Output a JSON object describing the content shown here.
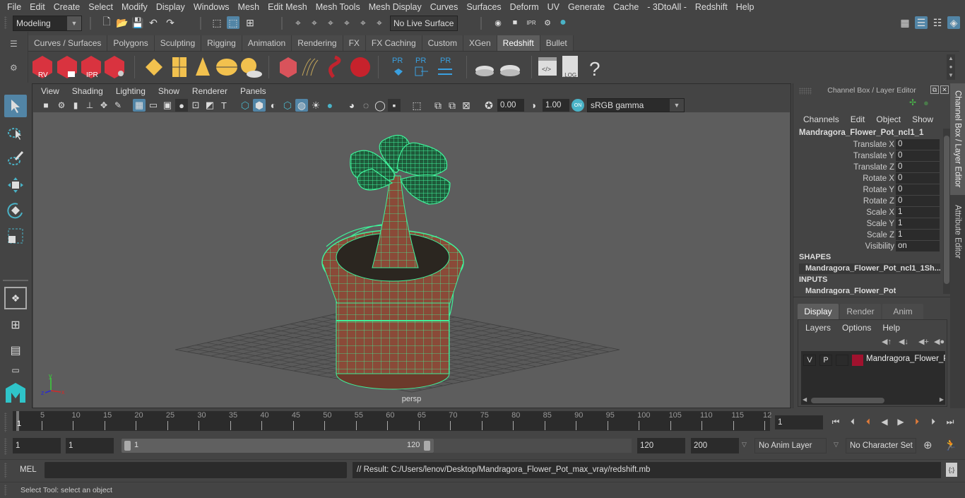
{
  "menubar": [
    "File",
    "Edit",
    "Create",
    "Select",
    "Modify",
    "Display",
    "Windows",
    "Mesh",
    "Edit Mesh",
    "Mesh Tools",
    "Mesh Display",
    "Curves",
    "Surfaces",
    "Deform",
    "UV",
    "Generate",
    "Cache",
    "- 3DtoAll -",
    "Redshift",
    "Help"
  ],
  "statusline": {
    "mode": "Modeling",
    "live_surface": "No Live Surface"
  },
  "shelf": {
    "tabs": [
      "Curves / Surfaces",
      "Polygons",
      "Sculpting",
      "Rigging",
      "Animation",
      "Rendering",
      "FX",
      "FX Caching",
      "Custom",
      "XGen",
      "Redshift",
      "Bullet"
    ],
    "active_tab": "Redshift",
    "icons": [
      {
        "name": "redshift-render-view",
        "label": "RV"
      },
      {
        "name": "redshift-batch-render",
        "label": ""
      },
      {
        "name": "redshift-ipr",
        "label": "IPR"
      },
      {
        "name": "redshift-render-settings",
        "label": ""
      },
      {
        "name": "redshift-light-rect",
        "label": ""
      },
      {
        "name": "redshift-light-portal",
        "label": ""
      },
      {
        "name": "redshift-light-spot",
        "label": ""
      },
      {
        "name": "redshift-dome-light",
        "label": ""
      },
      {
        "name": "redshift-sun-sky",
        "label": ""
      },
      {
        "name": "redshift-proxy",
        "label": ""
      },
      {
        "name": "redshift-hair",
        "label": ""
      },
      {
        "name": "redshift-volume",
        "label": ""
      },
      {
        "name": "redshift-sphere",
        "label": ""
      },
      {
        "name": "pr-material",
        "label": "PR"
      },
      {
        "name": "pr-export",
        "label": "PR"
      },
      {
        "name": "pr-convert",
        "label": "PR"
      },
      {
        "name": "bake-pies",
        "label": ""
      },
      {
        "name": "bake-pie",
        "label": ""
      },
      {
        "name": "script-editor",
        "label": ""
      },
      {
        "name": "log-file",
        "label": ".LOG"
      },
      {
        "name": "help",
        "label": "?"
      }
    ]
  },
  "viewport": {
    "menu": [
      "View",
      "Shading",
      "Lighting",
      "Show",
      "Renderer",
      "Panels"
    ],
    "exposure": "0.00",
    "gamma": "1.00",
    "color_space": "sRGB gamma",
    "camera_label": "persp",
    "axis": {
      "x": "x",
      "y": "y",
      "z": "z"
    }
  },
  "channelbox": {
    "title": "Channel Box / Layer Editor",
    "menu": [
      "Channels",
      "Edit",
      "Object",
      "Show"
    ],
    "object_name": "Mandragora_Flower_Pot_ncl1_1",
    "attributes": [
      {
        "label": "Translate X",
        "value": "0"
      },
      {
        "label": "Translate Y",
        "value": "0"
      },
      {
        "label": "Translate Z",
        "value": "0"
      },
      {
        "label": "Rotate X",
        "value": "0"
      },
      {
        "label": "Rotate Y",
        "value": "0"
      },
      {
        "label": "Rotate Z",
        "value": "0"
      },
      {
        "label": "Scale X",
        "value": "1"
      },
      {
        "label": "Scale Y",
        "value": "1"
      },
      {
        "label": "Scale Z",
        "value": "1"
      },
      {
        "label": "Visibility",
        "value": "on"
      }
    ],
    "shapes_header": "SHAPES",
    "shape_name": "Mandragora_Flower_Pot_ncl1_1Sh...",
    "inputs_header": "INPUTS",
    "input_name": "Mandragora_Flower_Pot"
  },
  "layereditor": {
    "tabs": [
      "Display",
      "Render",
      "Anim"
    ],
    "active_tab": "Display",
    "menu": [
      "Layers",
      "Options",
      "Help"
    ],
    "layers": [
      {
        "v": "V",
        "p": "P",
        "color": "#a0122e",
        "name": "Mandragora_Flower_P"
      }
    ]
  },
  "sidetabs": [
    "Channel Box / Layer Editor",
    "Attribute Editor"
  ],
  "timeline": {
    "ticks": [
      5,
      10,
      15,
      20,
      25,
      30,
      35,
      40,
      45,
      50,
      55,
      60,
      65,
      70,
      75,
      80,
      85,
      90,
      95,
      100,
      105,
      110,
      115,
      "12"
    ],
    "current_frame_marker": "1",
    "current_frame": "1"
  },
  "range": {
    "start": "1",
    "anim_start": "1",
    "slider_start": "1",
    "slider_end": "120",
    "end": "120",
    "anim_end": "200",
    "anim_layer": "No Anim Layer",
    "character_set": "No Character Set"
  },
  "cmdline": {
    "lang": "MEL",
    "input": "",
    "result": "// Result: C:/Users/lenov/Desktop/Mandragora_Flower_Pot_max_vray/redshift.mb"
  },
  "helpline": "Select Tool: select an object",
  "colors": {
    "accent": "#5285a6",
    "wire": "#3ff29a",
    "pot": "#8a4a38",
    "keyframe": "#e07b39"
  }
}
